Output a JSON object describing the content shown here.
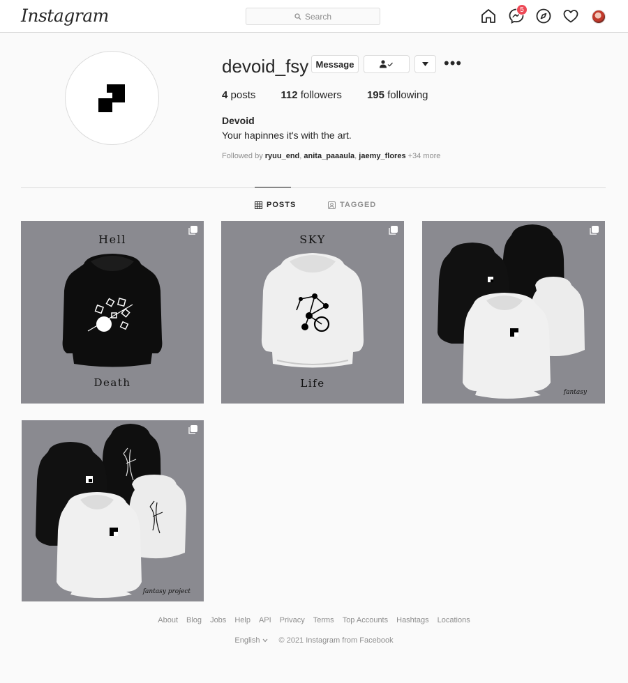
{
  "nav": {
    "logo": "Instagram",
    "search_placeholder": "Search",
    "messages_badge": "5"
  },
  "profile": {
    "username": "devoid_fsy",
    "message_button": "Message",
    "stats": {
      "posts_count": "4",
      "posts_label": "posts",
      "followers_count": "112",
      "followers_label": "followers",
      "following_count": "195",
      "following_label": "following"
    },
    "full_name": "Devoid",
    "bio": "Your hapinnes it's with the art.",
    "followed_by": {
      "prefix": "Followed by",
      "user1": "ryuu_end",
      "user2": "anita_paaaula",
      "user3": "jaemy_flores",
      "more": "+34 more"
    }
  },
  "tabs": {
    "posts": "POSTS",
    "tagged": "TAGGED"
  },
  "posts": [
    {
      "top_text": "Hell",
      "bottom_text": "Death"
    },
    {
      "top_text": "SKY",
      "bottom_text": "Life"
    },
    {
      "caption": "fantasy"
    },
    {
      "caption": "fantasy project"
    }
  ],
  "footer": {
    "links": [
      "About",
      "Blog",
      "Jobs",
      "Help",
      "API",
      "Privacy",
      "Terms",
      "Top Accounts",
      "Hashtags",
      "Locations"
    ],
    "language": "English",
    "copyright": "© 2021 Instagram from Facebook"
  },
  "colors": {
    "badge": "#ed4956",
    "post_background": "#8a8a90",
    "border": "#dbdbdb"
  }
}
